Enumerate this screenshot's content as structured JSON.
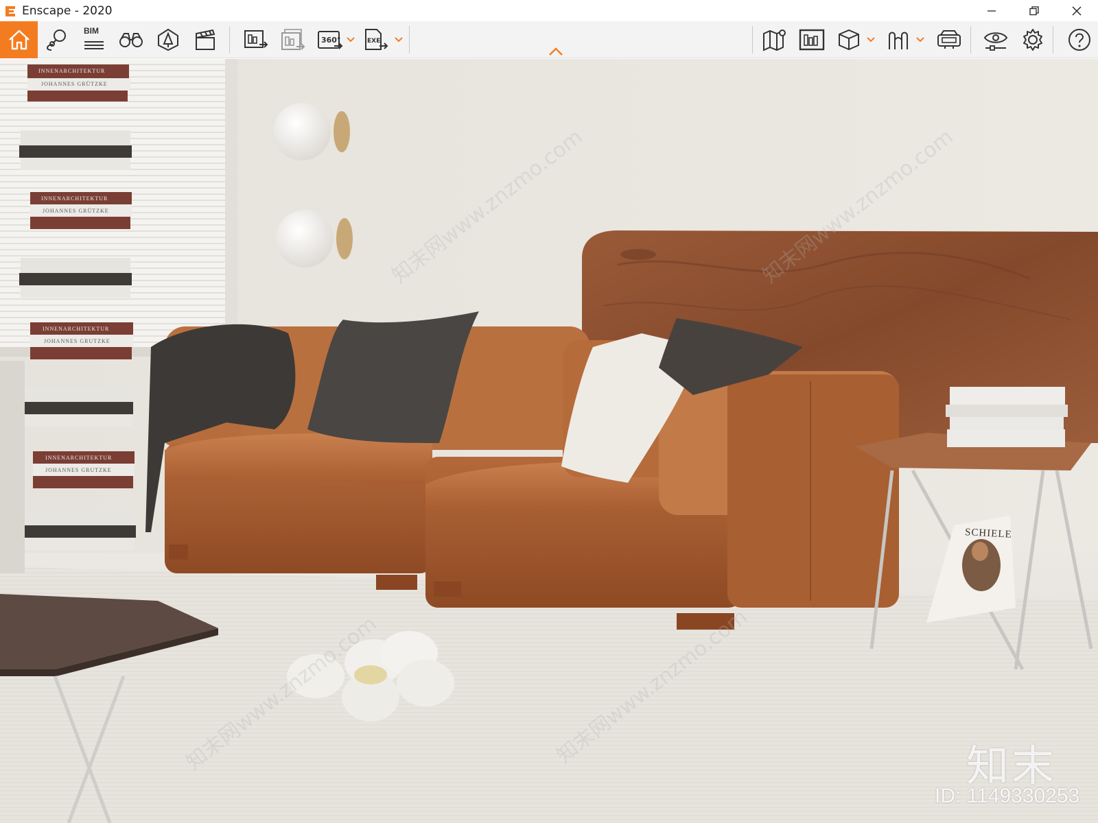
{
  "window": {
    "title": "Enscape - 2020",
    "minimize_icon": "minimize-icon",
    "restore_icon": "restore-icon",
    "close_icon": "close-icon"
  },
  "toolbar": {
    "accent_color": "#f47c20",
    "left_buttons": [
      {
        "name": "home-button",
        "icon": "home-icon"
      },
      {
        "name": "location-button",
        "icon": "map-pin-icon"
      },
      {
        "name": "bim-button",
        "icon": "bim-icon",
        "label": "BIM"
      },
      {
        "name": "views-button",
        "icon": "binoculars-icon"
      },
      {
        "name": "assets-button",
        "icon": "asset-library-icon"
      },
      {
        "name": "video-editor-button",
        "icon": "clapperboard-icon"
      },
      {
        "name": "screenshot-button",
        "icon": "render-screenshot-icon"
      },
      {
        "name": "batch-render-button",
        "icon": "batch-render-icon"
      },
      {
        "name": "panorama-button",
        "icon": "panorama-360-icon",
        "label": "360°"
      },
      {
        "name": "export-exe-button",
        "icon": "export-exe-icon",
        "label": "EXE"
      }
    ],
    "right_buttons": [
      {
        "name": "map-button",
        "icon": "map-icon"
      },
      {
        "name": "material-editor-button",
        "icon": "material-editor-icon"
      },
      {
        "name": "view-mode-button",
        "icon": "cube-icon"
      },
      {
        "name": "walk-mode-button",
        "icon": "people-icon"
      },
      {
        "name": "vr-headset-button",
        "icon": "vr-headset-icon"
      },
      {
        "name": "visual-settings-button",
        "icon": "eye-settings-icon"
      },
      {
        "name": "settings-button",
        "icon": "gear-icon"
      },
      {
        "name": "help-button",
        "icon": "help-icon"
      }
    ],
    "collapse_icon": "chevron-up-icon"
  },
  "scene": {
    "book_labels": [
      "INNENARCHITEKTUR",
      "JOHANNES GRÜTZKE",
      "INNENARCHITEKTUR",
      "JOHANNES GRÜTZKE",
      "INNENARCHITEKTUR",
      "JOHANNES GRUTZKE",
      "INNENARCHITEKTUR",
      "JOHANNES GRUTZKE"
    ],
    "poster_title": "SCHIELE",
    "watermark_logo": "知末",
    "watermark_id": "ID: 1149330253",
    "watermark_diagonal": "知末网www.znzmo.com",
    "colors": {
      "wall": "#ebe7e1",
      "floor": "#e4e0d9",
      "sofa": "#b56a3c",
      "headboard": "#8a4f30"
    }
  }
}
